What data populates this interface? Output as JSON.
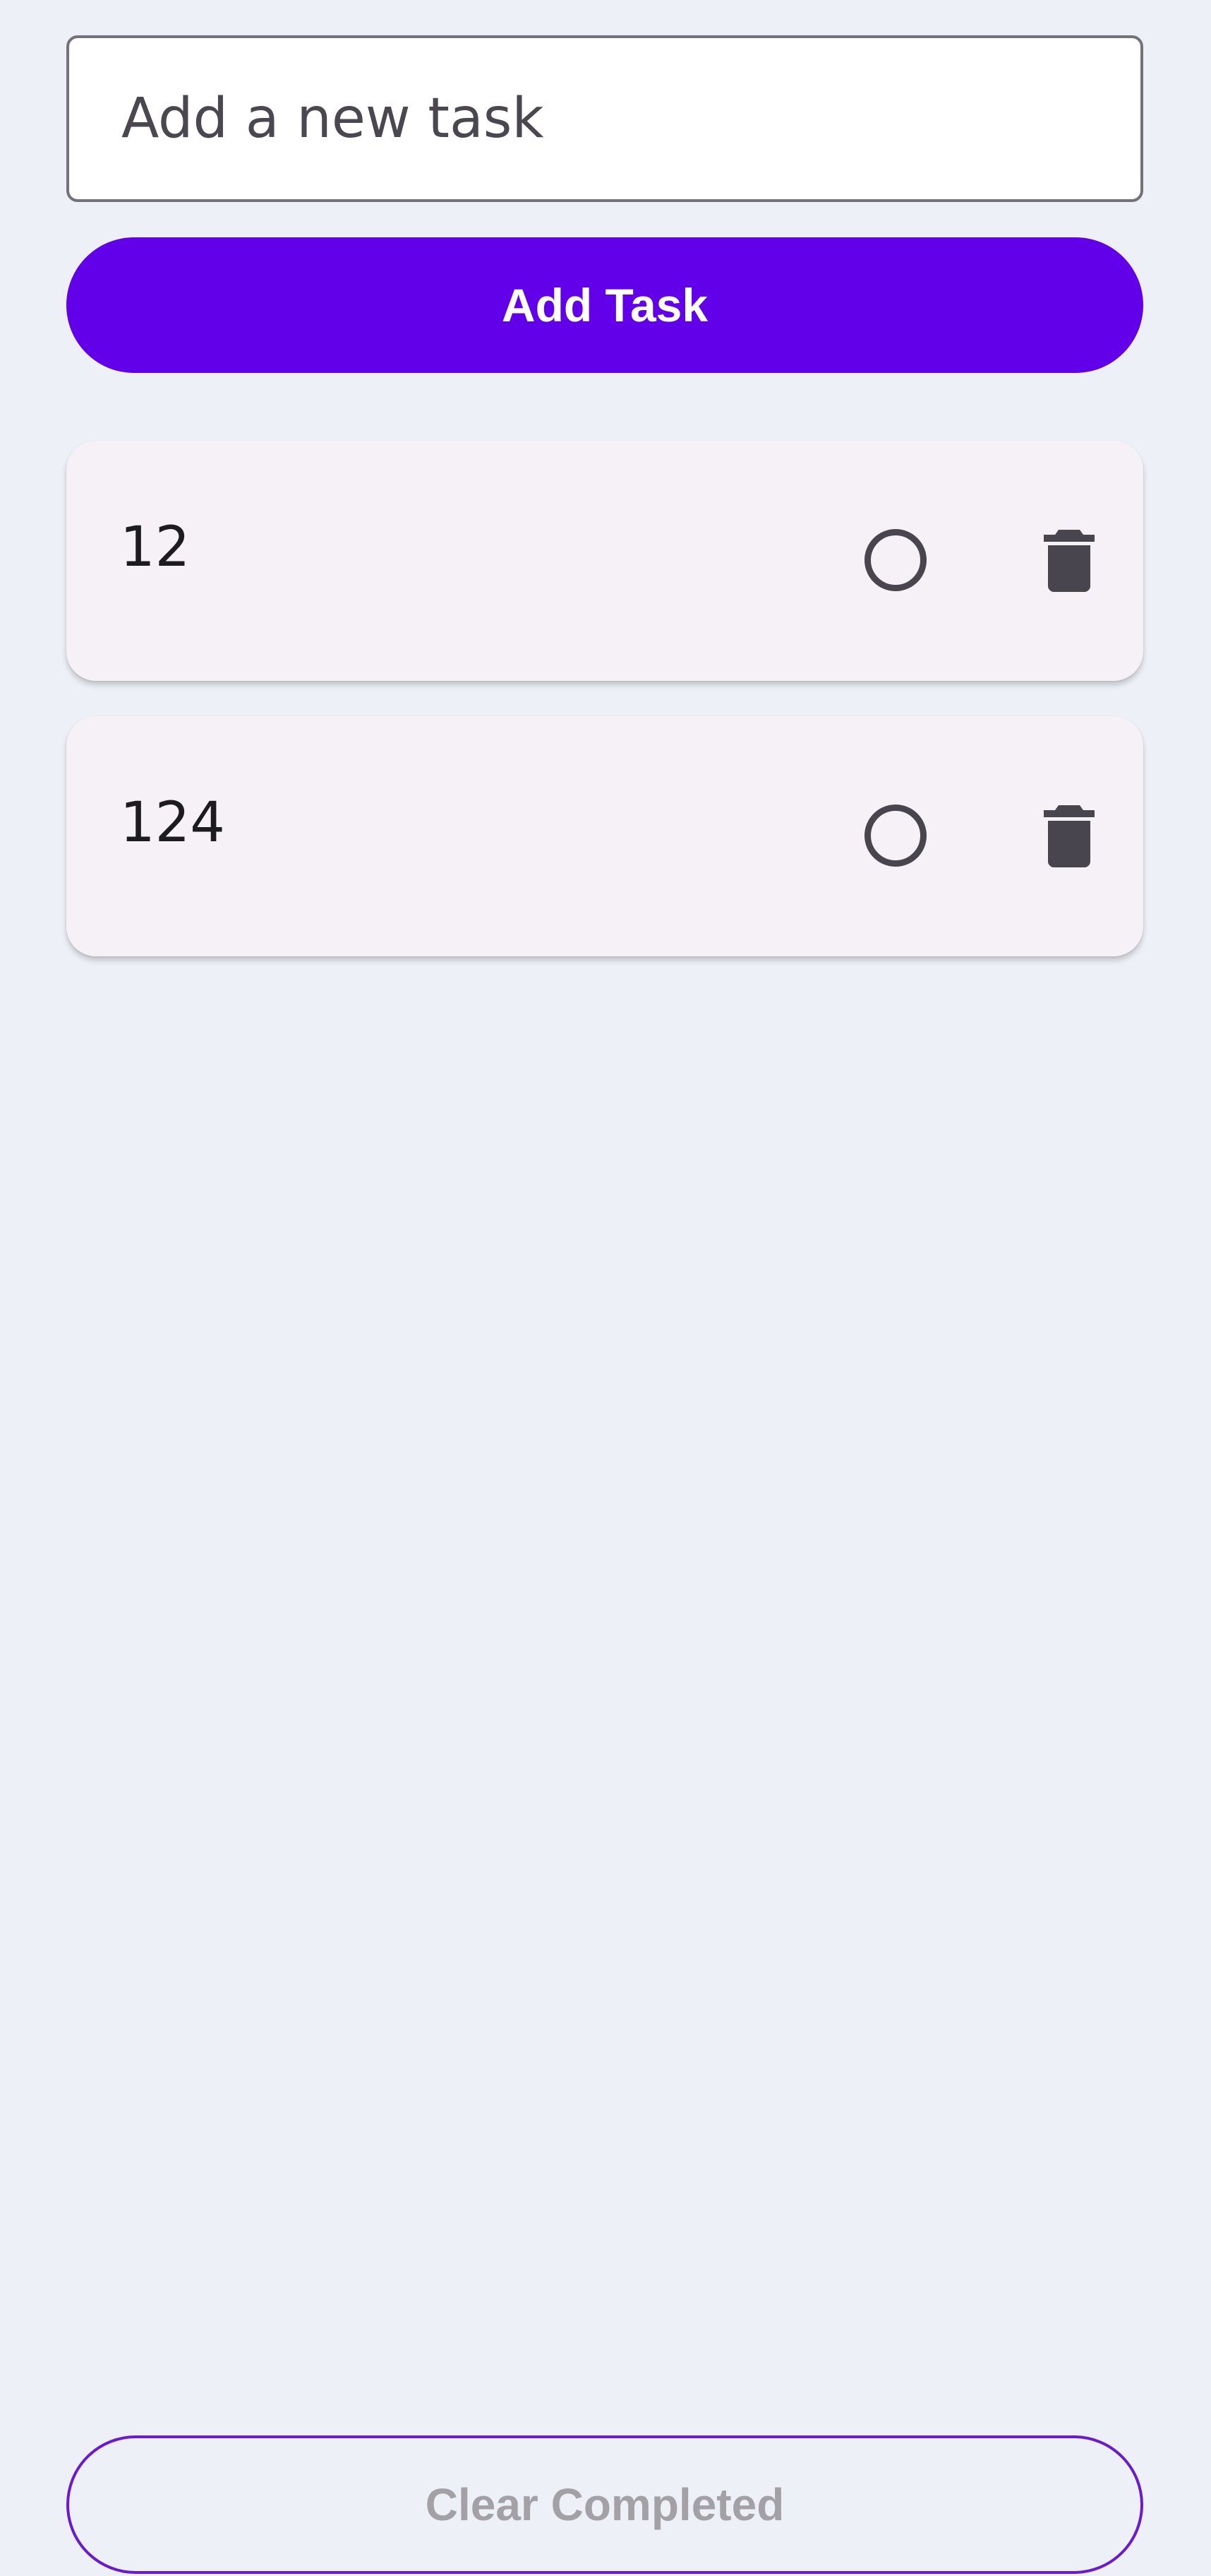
{
  "new_task": {
    "placeholder": "Add a new task",
    "value": ""
  },
  "add_button_label": "Add Task",
  "tasks": [
    {
      "text": "12",
      "completed": false,
      "toggle_icon": "circle-outline-icon",
      "delete_icon": "trash-icon"
    },
    {
      "text": "124",
      "completed": false,
      "toggle_icon": "circle-outline-icon",
      "delete_icon": "trash-icon"
    }
  ],
  "clear_button_label": "Clear Completed",
  "colors": {
    "background": "#edf1f7",
    "primary": "#6200ea",
    "card": "#f5f1f7",
    "icon": "#49454f",
    "disabled_text": "#a3a1a6"
  }
}
